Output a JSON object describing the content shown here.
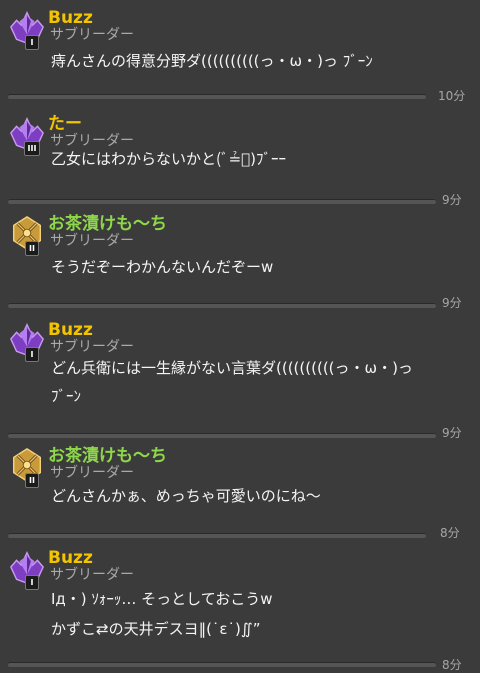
{
  "colors": {
    "name_gold": "#f3c400",
    "name_green": "#8ed74a",
    "role_gray": "#a9a9a9",
    "background": "#3b3b3b"
  },
  "messages": [
    {
      "name": "Buzz",
      "role": "サブリーダー",
      "rank": "I",
      "badge": "purple-league-badge-icon",
      "lines": [
        "痔んさんの得意分野ダ((((((((((っ・ω・)っ ﾌﾞｰﾝ"
      ],
      "time": "10分"
    },
    {
      "name": "たー",
      "role": "サブリーダー",
      "rank": "III",
      "badge": "purple-league-badge-icon",
      "lines": [
        "乙女にはわからないかと(ﾞ≟ﾞ)ﾌﾞｰｰ"
      ],
      "time": "9分"
    },
    {
      "name": "お茶漬けも〜ち",
      "role": "サブリーダー",
      "rank": "II",
      "badge": "gold-league-badge-icon",
      "lines": [
        "そうだぞーわかんないんだぞーw"
      ],
      "time": "9分"
    },
    {
      "name": "Buzz",
      "role": "サブリーダー",
      "rank": "I",
      "badge": "purple-league-badge-icon",
      "lines": [
        "どん兵衛には一生縁がない言葉ダ((((((((((っ・ω・)っ",
        "ﾌﾞｰﾝ"
      ],
      "time": "9分"
    },
    {
      "name": "お茶漬けも〜ち",
      "role": "サブリーダー",
      "rank": "II",
      "badge": "gold-league-badge-icon",
      "lines": [
        "どんさんかぁ、めっちゃ可愛いのにね〜"
      ],
      "time": "8分"
    },
    {
      "name": "Buzz",
      "role": "サブリーダー",
      "rank": "I",
      "badge": "purple-league-badge-icon",
      "lines": [
        "Iд・) ｿｫｰｯ… そっとしておこうw",
        "かずこ⇄の天井デスヨ‖(˙ε˙)∬”"
      ],
      "time": "8分"
    }
  ]
}
